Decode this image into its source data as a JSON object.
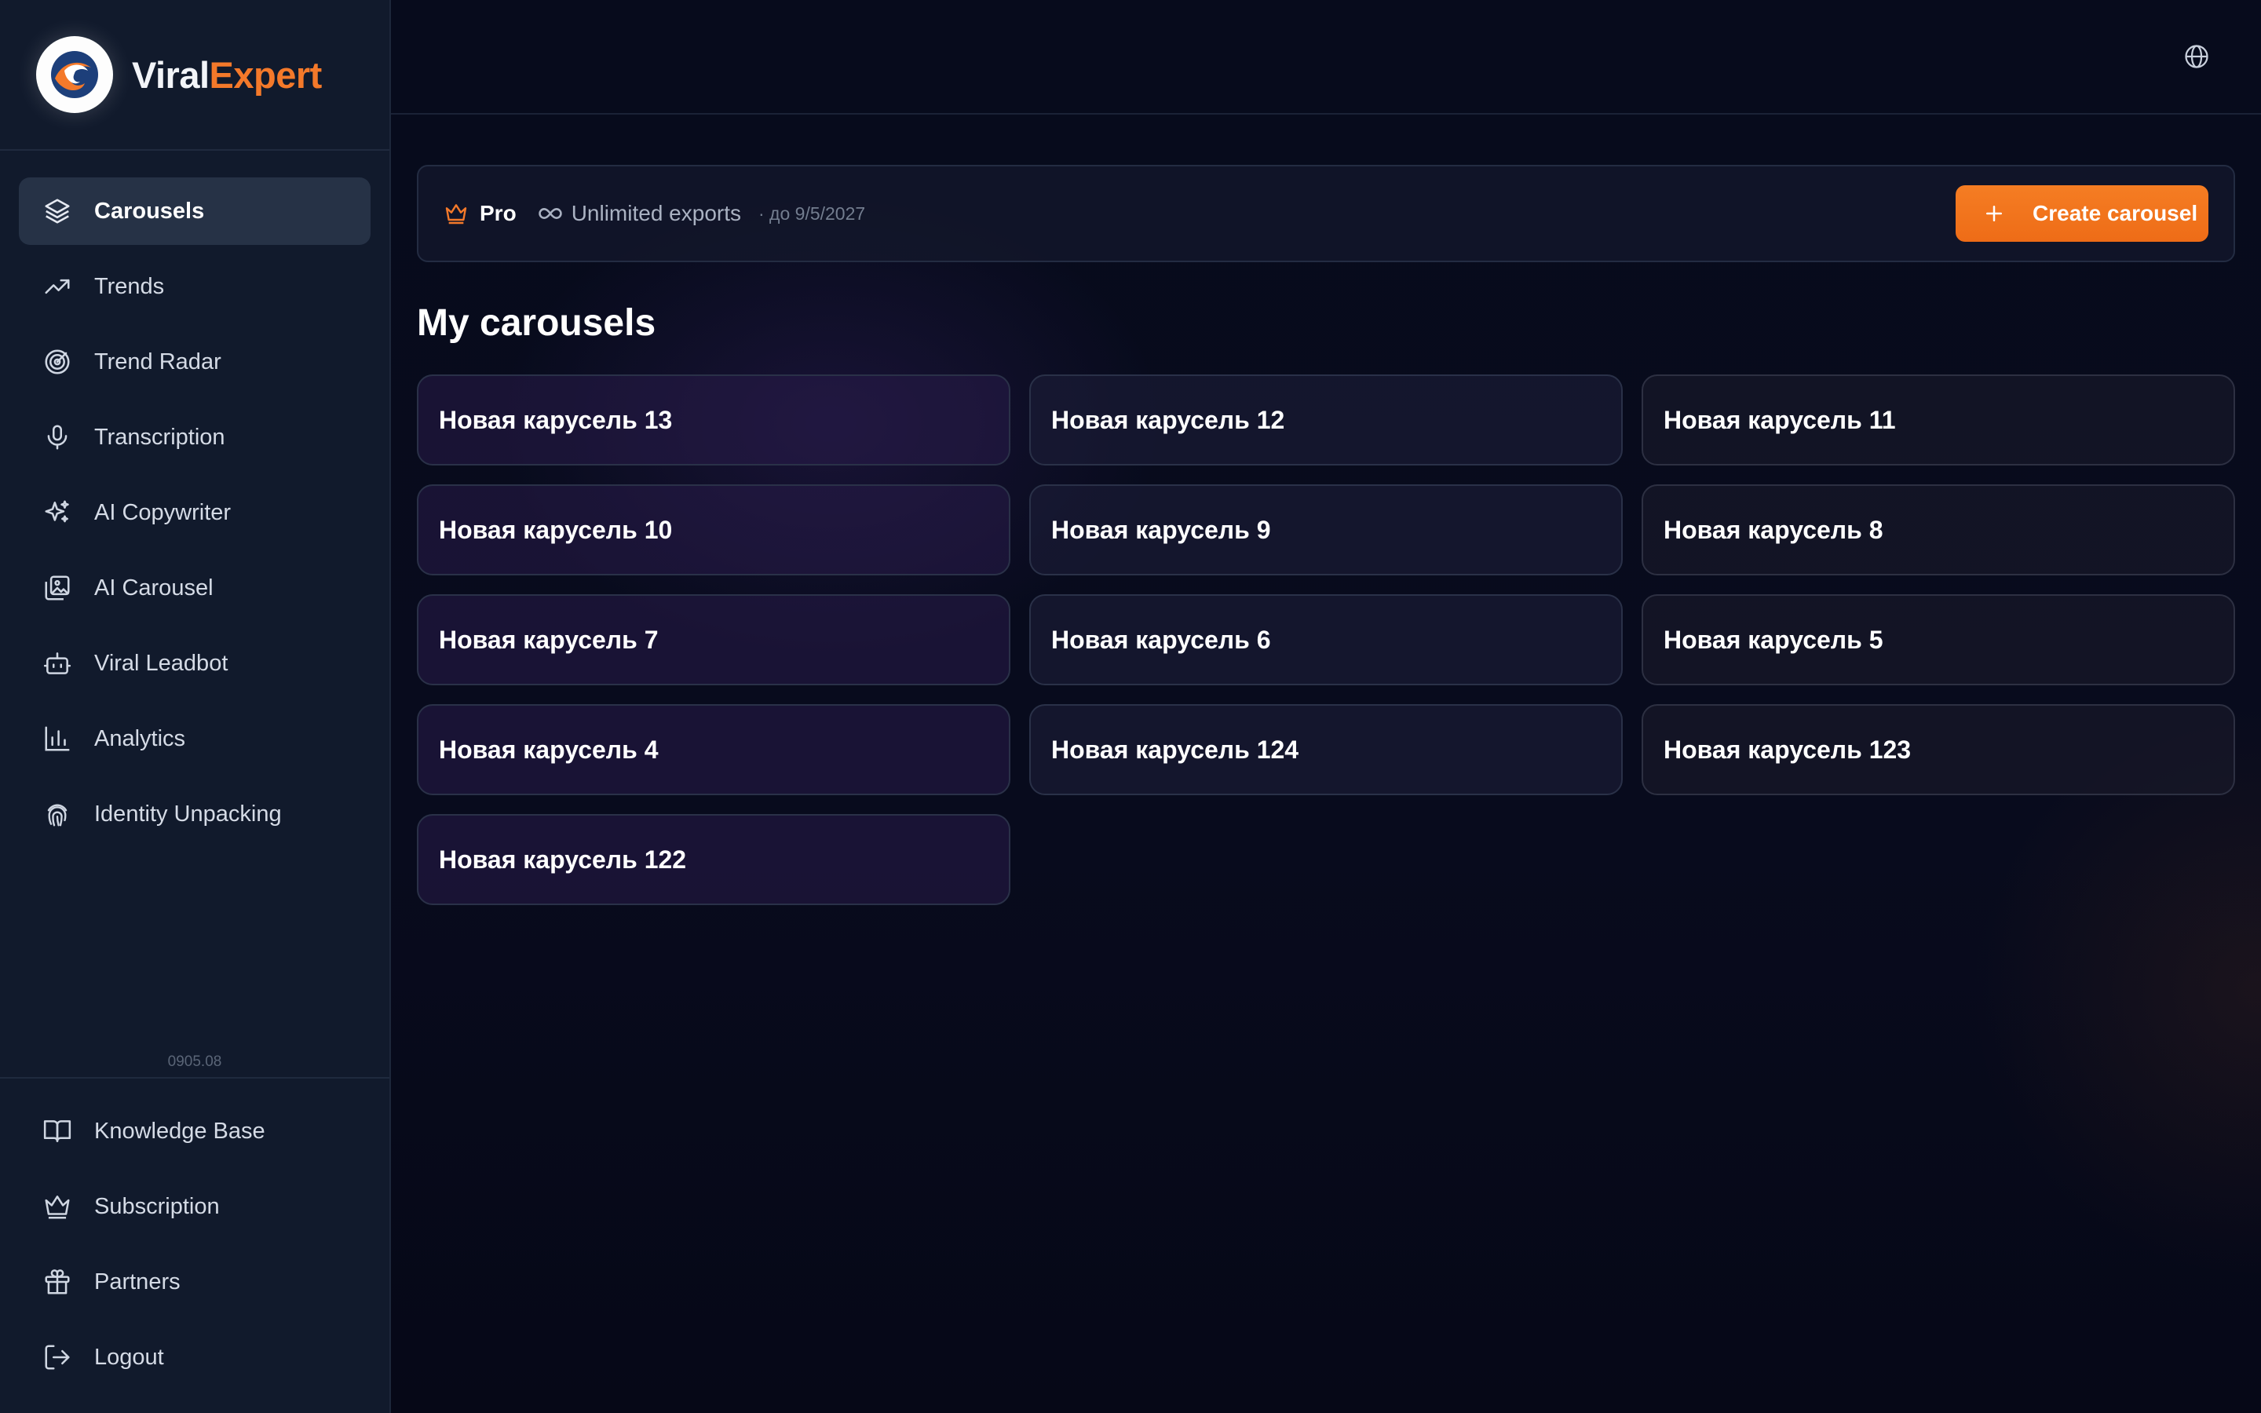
{
  "brand": {
    "name_part1": "Viral",
    "name_part2": "Expert"
  },
  "sidebar": {
    "items": [
      {
        "label": "Carousels",
        "icon": "layers-icon",
        "active": true
      },
      {
        "label": "Trends",
        "icon": "trending-up-icon"
      },
      {
        "label": "Trend Radar",
        "icon": "radar-icon"
      },
      {
        "label": "Transcription",
        "icon": "microphone-icon"
      },
      {
        "label": "AI Copywriter",
        "icon": "sparkles-icon"
      },
      {
        "label": "AI Carousel",
        "icon": "image-stack-icon"
      },
      {
        "label": "Viral Leadbot",
        "icon": "bot-icon"
      },
      {
        "label": "Analytics",
        "icon": "bar-chart-icon"
      },
      {
        "label": "Identity Unpacking",
        "icon": "fingerprint-icon"
      }
    ],
    "version": "0905.08",
    "bottom_items": [
      {
        "label": "Knowledge Base",
        "icon": "book-icon"
      },
      {
        "label": "Subscription",
        "icon": "crown-icon"
      },
      {
        "label": "Partners",
        "icon": "gift-icon"
      },
      {
        "label": "Logout",
        "icon": "logout-icon"
      }
    ]
  },
  "topbar": {
    "language_icon": "globe-icon"
  },
  "plan": {
    "name": "Pro",
    "exports": "Unlimited exports",
    "until": "· до 9/5/2027",
    "accent_color": "#f4792a"
  },
  "create_button": {
    "label": "Create carousel"
  },
  "main": {
    "title": "My carousels",
    "carousels": [
      "Новая карусель 13",
      "Новая карусель 12",
      "Новая карусель 11",
      "Новая карусель 10",
      "Новая карусель 9",
      "Новая карусель 8",
      "Новая карусель 7",
      "Новая карусель 6",
      "Новая карусель 5",
      "Новая карусель 4",
      "Новая карусель 124",
      "Новая карусель 123",
      "Новая карусель 122"
    ]
  }
}
